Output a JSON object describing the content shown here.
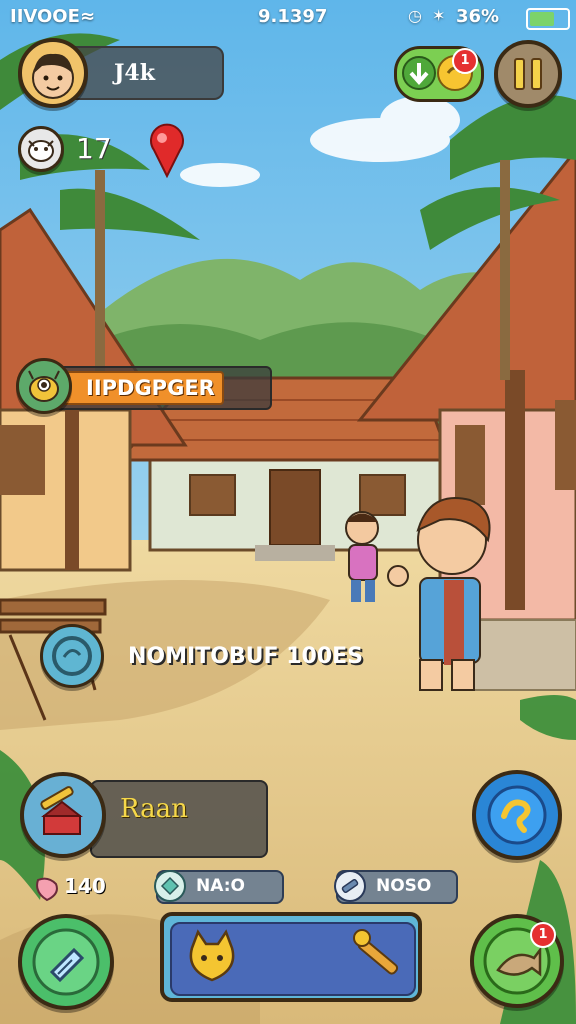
{
  "status_bar": {
    "carrier": "IIVOOE",
    "time": "9.1397",
    "battery_percent": "36%"
  },
  "player": {
    "name": "J4k",
    "coins": "17"
  },
  "quest_banner": {
    "label": "IIPDGPGER"
  },
  "object_label": {
    "text": "NOMITOBUF 100ES"
  },
  "action_panel": {
    "label": "Raan"
  },
  "currencies": [
    {
      "icon": "seed-icon",
      "value": "140"
    },
    {
      "icon": "gem-icon",
      "value": "NA:O"
    },
    {
      "icon": "tool-icon",
      "value": "NOSO"
    }
  ],
  "notifications": {
    "top_right_badge": "1",
    "bottom_right_badge": "1"
  },
  "colors": {
    "sky": "#8fcfee",
    "roof": "#b85a32",
    "ground": "#e6cf95",
    "panel_blue": "#4a6ab8",
    "accent_orange": "#f0902a",
    "accent_green": "#5fb04a"
  },
  "icons": {
    "avatar": "boy-face-icon",
    "coin": "cow-coin-icon",
    "map_pin": "map-pin-icon",
    "toggle": "arrow-coin-toggle-icon",
    "pause": "pause-icon",
    "quest": "monster-icon",
    "object": "target-icon",
    "action": "hammer-icon",
    "compass": "compass-icon",
    "left_button": "ticket-icon",
    "right_button": "fish-icon",
    "bar_left": "cat-icon",
    "bar_right": "hammer-icon"
  }
}
